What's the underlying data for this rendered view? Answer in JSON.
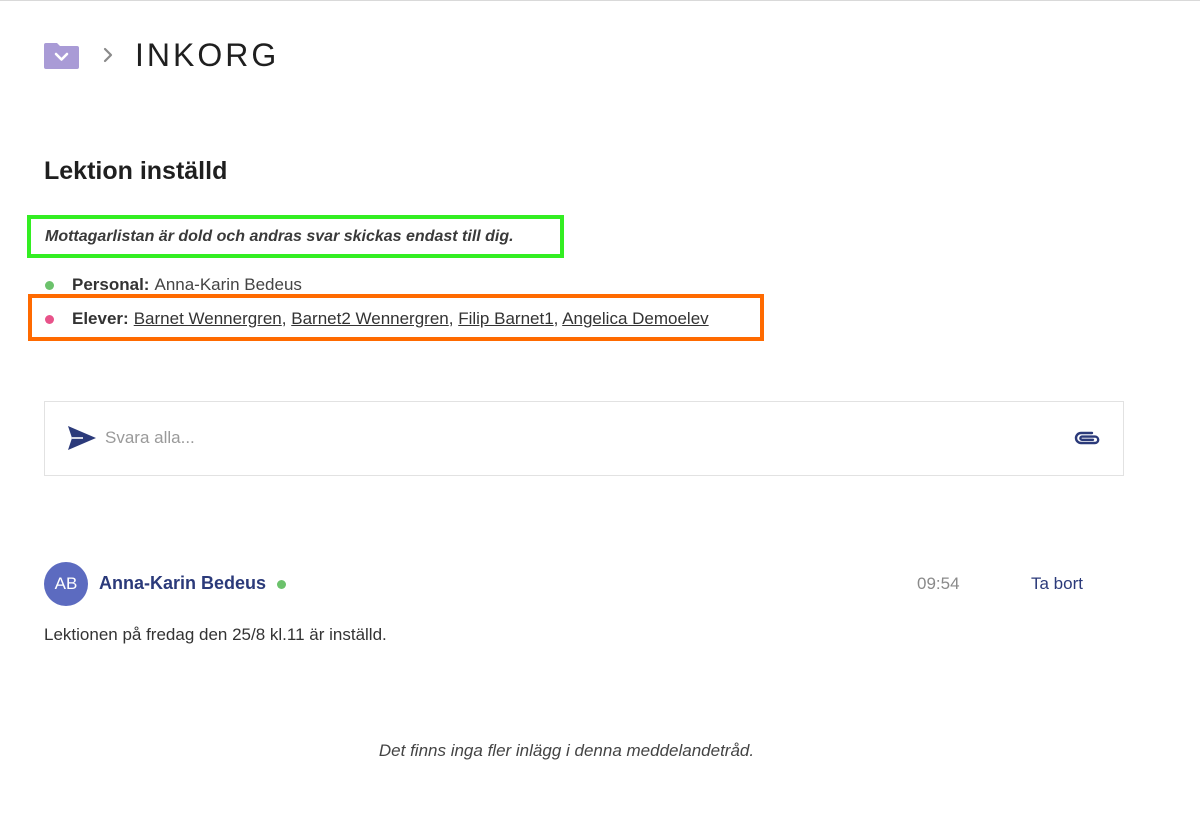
{
  "breadcrumb": {
    "title": "INKORG",
    "folder_icon": "folder-chevron-icon",
    "separator_icon": "chevron-right-icon"
  },
  "thread": {
    "title": "Lektion inställd",
    "hidden_notice": "Mottagarlistan är dold och andras svar skickas endast till dig."
  },
  "recipients": {
    "staff": {
      "label": "Personal:",
      "names": "Anna-Karin Bedeus",
      "color": "#6cc26c"
    },
    "students": {
      "label": "Elever:",
      "names": [
        "Barnet Wennergren",
        "Barnet2 Wennergren",
        "Filip Barnet1",
        "Angelica Demoelev"
      ],
      "separator": ",",
      "color": "#e8538a"
    }
  },
  "reply": {
    "placeholder": "Svara alla...",
    "send_icon": "send-icon",
    "attach_icon": "paperclip-icon"
  },
  "message": {
    "avatar_initials": "AB",
    "avatar_color": "#5c6bc0",
    "author": "Anna-Karin Bedeus",
    "online_color": "#6cc26c",
    "time": "09:54",
    "delete_label": "Ta bort",
    "body": "Lektionen på fredag den 25/8 kl.11 är inställd."
  },
  "footer": {
    "end_note": "Det finns inga fler inlägg i denna meddelandetråd."
  },
  "highlights": {
    "notice_box_color": "#33ee22",
    "students_box_color": "#ff6a00"
  },
  "colors": {
    "accent": "#2b3a7a",
    "folder": "#a99bd6"
  }
}
